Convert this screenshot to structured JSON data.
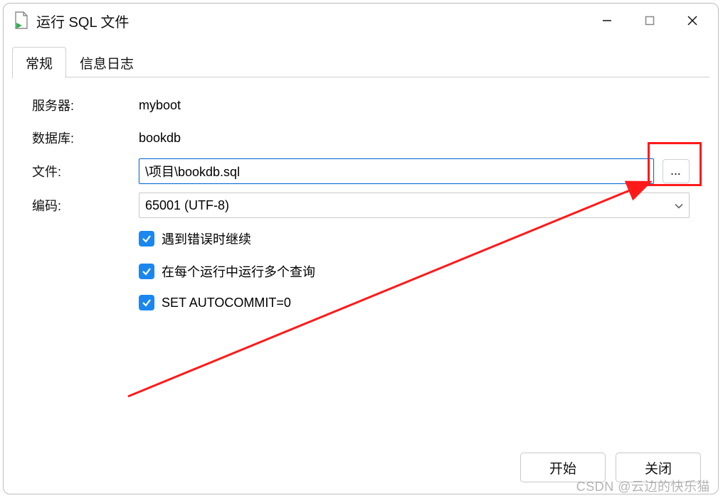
{
  "window": {
    "title": "运行 SQL 文件"
  },
  "tabs": {
    "general": "常规",
    "log": "信息日志"
  },
  "form": {
    "server_label": "服务器:",
    "server_value": "myboot",
    "database_label": "数据库:",
    "database_value": "bookdb",
    "file_label": "文件:",
    "file_value": "\\项目\\bookdb.sql",
    "encoding_label": "编码:",
    "encoding_value": "65001 (UTF-8)"
  },
  "checks": {
    "continue_on_error": "遇到错误时继续",
    "multi_query": "在每个运行中运行多个查询",
    "autocommit": "SET AUTOCOMMIT=0"
  },
  "buttons": {
    "browse": "...",
    "start": "开始",
    "close": "关闭"
  },
  "watermark": "CSDN @云边的快乐猫"
}
